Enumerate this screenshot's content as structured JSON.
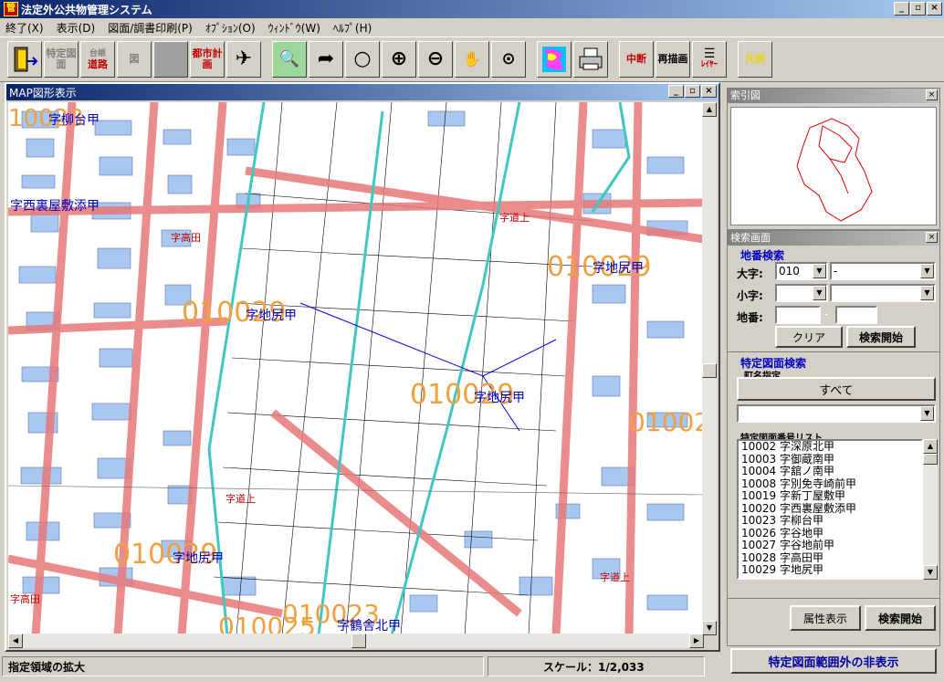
{
  "window": {
    "title": "法定外公共物管理システム",
    "icon_text": "管"
  },
  "title_buttons": [
    "_",
    "▫",
    "×"
  ],
  "menu": [
    "終了(X)",
    "表示(D)",
    "図面/調書印刷(P)",
    "ｵﾌﾟｼｮﾝ(O)",
    "ｳｨﾝﾄﾞｳ(W)",
    "ﾍﾙﾌﾟ(H)"
  ],
  "toolbar": {
    "exit": "",
    "specified_map": "特定図面",
    "road_ledger_top": "台帳",
    "road_ledger": "道路",
    "map": "図",
    "blank": "",
    "city_planning": "都市計画",
    "plane": "✈",
    "magnify": "🔍",
    "redo": "➦",
    "zoom": "○",
    "zoom_in": "⊕",
    "zoom_out": "⊖",
    "pan": "✋",
    "center": "⊙",
    "color_map": "",
    "print": "",
    "interrupt": "中断",
    "redraw": "再描画",
    "layer": "ﾚｲﾔｰ",
    "legend": "凡例"
  },
  "map_window": {
    "title": "MAP図形表示",
    "labels": [
      {
        "code": "10023",
        "name": "字柳台甲"
      },
      {
        "code": "010020",
        "name": "字西裏屋敷添甲"
      },
      {
        "code": "010029",
        "name": "字地尻甲"
      },
      {
        "code": "010029",
        "name": "字地尻甲"
      },
      {
        "code": "010029",
        "name": "字地尻甲"
      },
      {
        "code": "010029",
        "name": "字地尻甲"
      },
      {
        "code": "010023",
        "name": "字柳台甲"
      },
      {
        "code": "010025",
        "name": "字鶴舎北甲"
      },
      {
        "code": "01002",
        "name": ""
      }
    ],
    "road_labels": [
      "字道上",
      "字道上",
      "字道上",
      "字高田",
      "字高田"
    ]
  },
  "status": {
    "message": "指定領域の拡大",
    "scale": "スケール：1/2,033"
  },
  "index_panel": {
    "title": "索引図"
  },
  "search_panel": {
    "title": "検索画面",
    "lot_search_label": "地番検索",
    "oaza_label": "大字:",
    "oaza_code": "010",
    "oaza_name": "-",
    "koaza_label": "小字:",
    "koaza_code": "",
    "koaza_name": "",
    "chiban_label": "地番:",
    "chiban_1": "",
    "chiban_2": "",
    "chiban_sep": "-",
    "clear_button": "クリア",
    "search_button": "検索開始",
    "special_search_label": "特定図面検索",
    "town_label": "町名指定",
    "all_button": "すべて",
    "town_select": "",
    "list_label": "特定図面番号リスト",
    "list_items": [
      "10002 字深原北甲",
      "10003 字御蔵南甲",
      "10004 字舘ノ南甲",
      "10008 字別免寺崎前甲",
      "10019 字新丁屋敷甲",
      "10020 字西裏屋敷添甲",
      "10023 字柳台甲",
      "10026 字谷地甲",
      "10027 字谷地前甲",
      "10028 字高田甲",
      "10029 字地尻甲"
    ],
    "attr_button": "属性表示",
    "search_button2": "検索開始",
    "hide_button": "特定図面範囲外の非表示"
  }
}
